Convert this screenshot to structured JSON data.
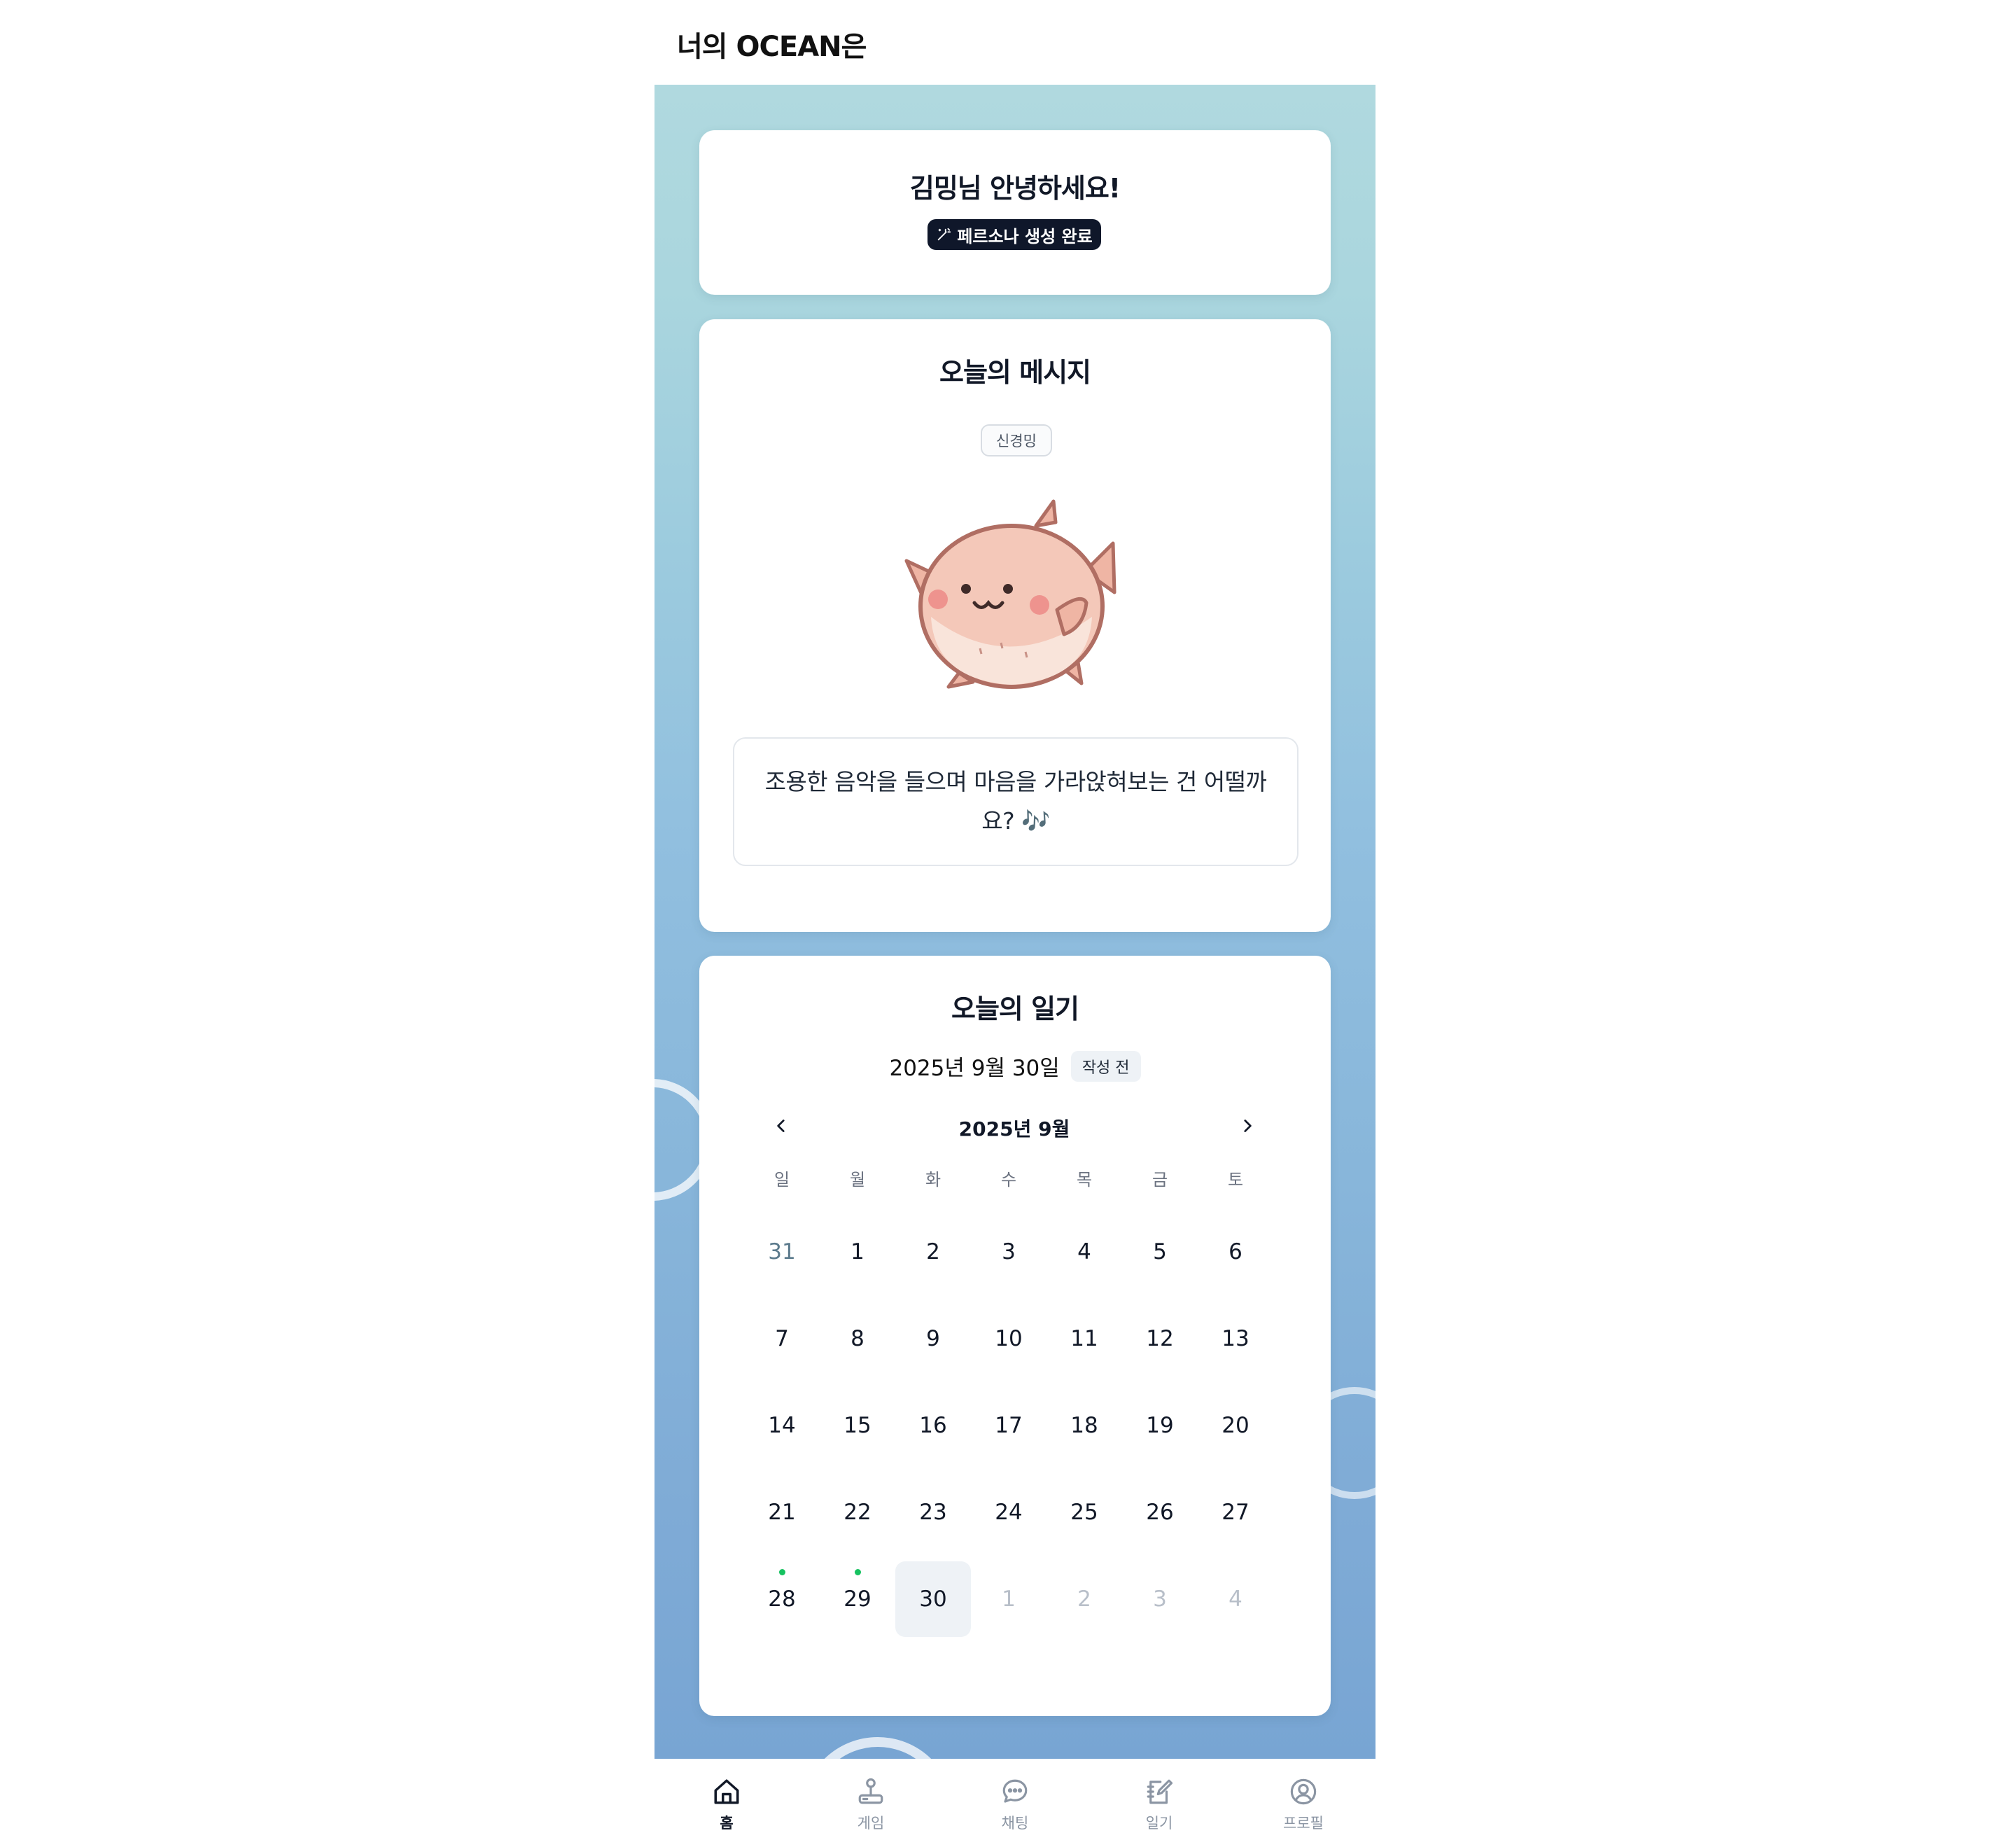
{
  "header": {
    "title": "너의 OCEAN은"
  },
  "greeting": {
    "title": "김밍님 안녕하세요!",
    "badge_icon": "magic-wand-icon",
    "badge_label": "페르소나 생성 완료"
  },
  "message_card": {
    "title": "오늘의 메시지",
    "trait": "신경밍",
    "character": "pufferfish-character",
    "message": "조용한 음악을 들으며 마음을 가라앉혀보는 건 어떨까요? 🎶"
  },
  "diary_card": {
    "title": "오늘의 일기",
    "date": "2025년 9월 30일",
    "status": "작성 전",
    "calendar": {
      "month_label": "2025년 9월",
      "prev_icon": "chevron-left-icon",
      "next_icon": "chevron-right-icon",
      "weekdays": [
        "일",
        "월",
        "화",
        "수",
        "목",
        "금",
        "토"
      ],
      "days": [
        {
          "label": "31",
          "type": "prev-month"
        },
        {
          "label": "1"
        },
        {
          "label": "2"
        },
        {
          "label": "3"
        },
        {
          "label": "4"
        },
        {
          "label": "5"
        },
        {
          "label": "6"
        },
        {
          "label": "7"
        },
        {
          "label": "8"
        },
        {
          "label": "9"
        },
        {
          "label": "10"
        },
        {
          "label": "11"
        },
        {
          "label": "12"
        },
        {
          "label": "13"
        },
        {
          "label": "14"
        },
        {
          "label": "15"
        },
        {
          "label": "16"
        },
        {
          "label": "17"
        },
        {
          "label": "18"
        },
        {
          "label": "19"
        },
        {
          "label": "20"
        },
        {
          "label": "21"
        },
        {
          "label": "22"
        },
        {
          "label": "23"
        },
        {
          "label": "24"
        },
        {
          "label": "25"
        },
        {
          "label": "26"
        },
        {
          "label": "27"
        },
        {
          "label": "28",
          "has_entry": true
        },
        {
          "label": "29",
          "has_entry": true
        },
        {
          "label": "30",
          "today": true
        },
        {
          "label": "1",
          "type": "next-month"
        },
        {
          "label": "2",
          "type": "next-month"
        },
        {
          "label": "3",
          "type": "next-month"
        },
        {
          "label": "4",
          "type": "next-month"
        }
      ],
      "entry_dot_color": "#16c260"
    }
  },
  "bottom_nav": [
    {
      "id": "home",
      "label": "홈",
      "icon": "home-icon",
      "active": true
    },
    {
      "id": "game",
      "label": "게임",
      "icon": "joystick-icon",
      "active": false
    },
    {
      "id": "chat",
      "label": "채팅",
      "icon": "chat-bubble-icon",
      "active": false
    },
    {
      "id": "diary",
      "label": "일기",
      "icon": "notebook-pen-icon",
      "active": false
    },
    {
      "id": "profile",
      "label": "프로필",
      "icon": "user-circle-icon",
      "active": false
    }
  ],
  "colors": {
    "ocean_top": "#b0d9df",
    "ocean_bottom": "#78a5d3",
    "badge_bg": "#0f172a",
    "entry_dot": "#16c260"
  }
}
